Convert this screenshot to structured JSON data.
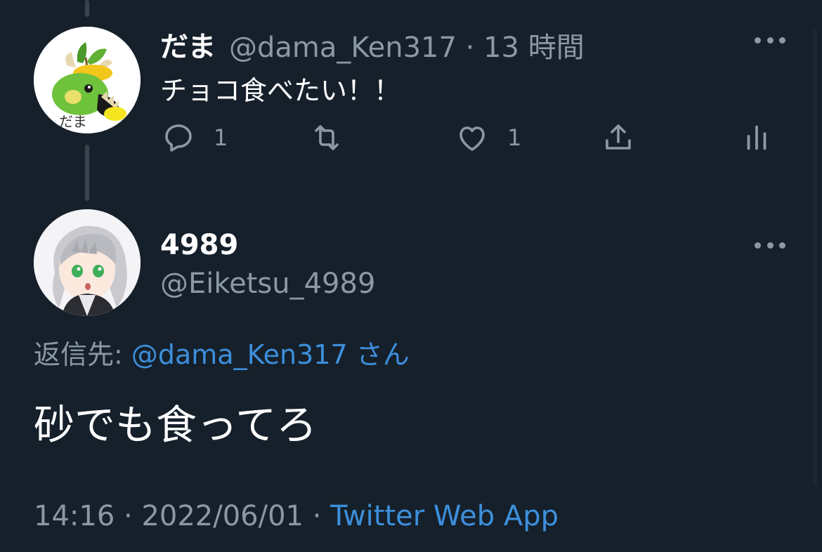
{
  "tweet1": {
    "display_name": "だま",
    "handle": "@dama_Ken317",
    "separator": "·",
    "time": "13 時間",
    "text": "チョコ食べたい！！",
    "reply_count": "1",
    "like_count": "1"
  },
  "tweet2": {
    "display_name": "4989",
    "handle": "@Eiketsu_4989",
    "reply_to_prefix": "返信先: ",
    "reply_to_handle": "@dama_Ken317",
    "reply_to_suffix": " さん",
    "text": "砂でも食ってろ",
    "time": "14:16",
    "sep1": " · ",
    "date": "2022/06/01",
    "sep2": " · ",
    "client": "Twitter Web App"
  },
  "colors": {
    "background": "#15202b",
    "secondary_text": "#8b98a5",
    "link": "#3d8fdb"
  },
  "icons": [
    "reply-icon",
    "retweet-icon",
    "like-icon",
    "share-icon",
    "analytics-icon",
    "more-icon"
  ]
}
